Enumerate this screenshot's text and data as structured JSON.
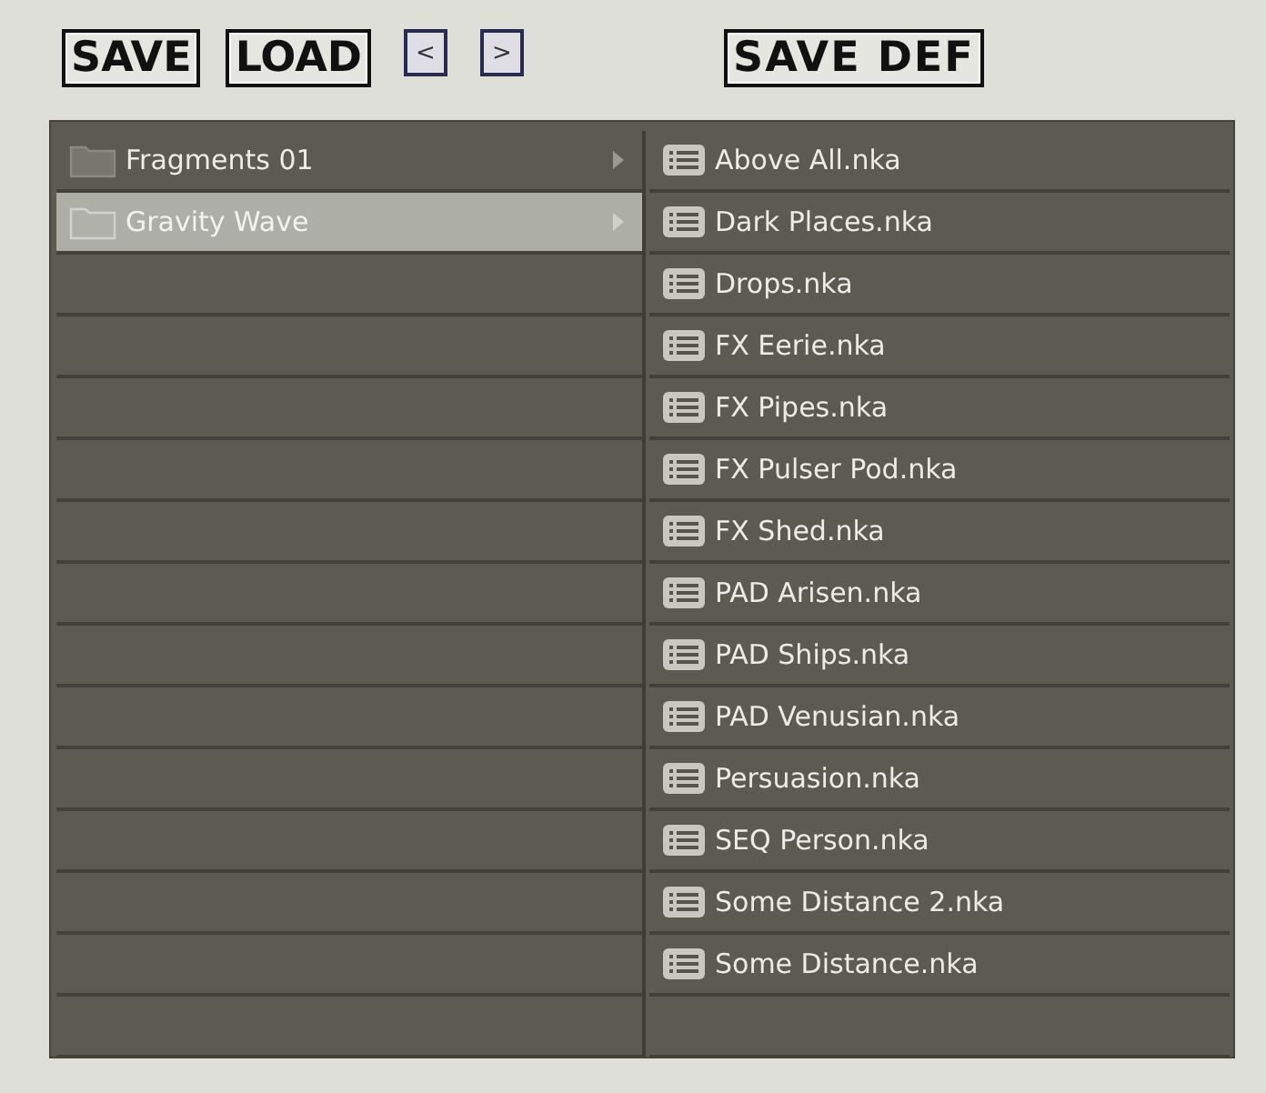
{
  "toolbar": {
    "buttons": [
      {
        "label": "SAVE",
        "kind": "text"
      },
      {
        "label": "LOAD",
        "kind": "text"
      },
      {
        "label": "<",
        "kind": "nav"
      },
      {
        "label": ">",
        "kind": "nav"
      },
      {
        "label": "SAVE DEF",
        "kind": "text"
      }
    ]
  },
  "folders": [
    {
      "name": "Fragments 01",
      "selected": false
    },
    {
      "name": "Gravity Wave",
      "selected": true
    }
  ],
  "files": [
    {
      "name": "Above All.nka"
    },
    {
      "name": "Dark Places.nka"
    },
    {
      "name": "Drops.nka"
    },
    {
      "name": "FX Eerie.nka"
    },
    {
      "name": "FX Pipes.nka"
    },
    {
      "name": "FX Pulser Pod.nka"
    },
    {
      "name": "FX Shed.nka"
    },
    {
      "name": "PAD Arisen.nka"
    },
    {
      "name": "PAD Ships.nka"
    },
    {
      "name": "PAD Venusian.nka"
    },
    {
      "name": "Persuasion.nka"
    },
    {
      "name": "SEQ Person.nka"
    },
    {
      "name": "Some Distance 2.nka"
    },
    {
      "name": "Some Distance.nka"
    }
  ]
}
